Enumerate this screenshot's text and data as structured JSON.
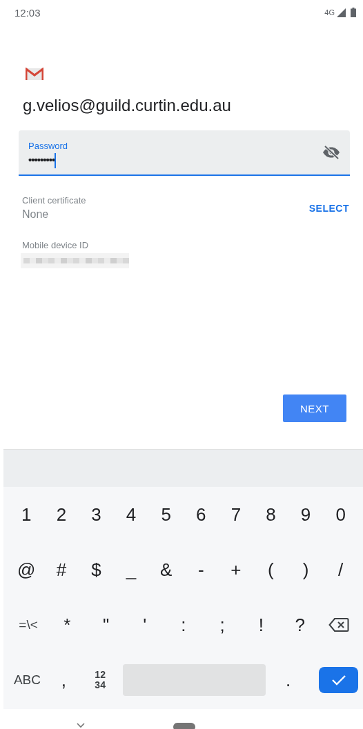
{
  "status_bar": {
    "time": "12:03",
    "network": "4G"
  },
  "account": {
    "email": "g.velios@guild.curtin.edu.au"
  },
  "password_field": {
    "label": "Password",
    "value": "•••••••••",
    "focused": true
  },
  "client_certificate": {
    "label": "Client certificate",
    "value": "None",
    "action": "SELECT"
  },
  "mobile_device_id": {
    "label": "Mobile device ID"
  },
  "next_button": {
    "label": "NEXT"
  },
  "keyboard": {
    "rows": [
      [
        {
          "kind": "char",
          "label": "1"
        },
        {
          "kind": "char",
          "label": "2"
        },
        {
          "kind": "char",
          "label": "3"
        },
        {
          "kind": "char",
          "label": "4"
        },
        {
          "kind": "char",
          "label": "5"
        },
        {
          "kind": "char",
          "label": "6"
        },
        {
          "kind": "char",
          "label": "7"
        },
        {
          "kind": "char",
          "label": "8"
        },
        {
          "kind": "char",
          "label": "9"
        },
        {
          "kind": "char",
          "label": "0"
        }
      ],
      [
        {
          "kind": "char",
          "label": "@"
        },
        {
          "kind": "char",
          "label": "#"
        },
        {
          "kind": "char",
          "label": "$"
        },
        {
          "kind": "char",
          "label": "_"
        },
        {
          "kind": "char",
          "label": "&"
        },
        {
          "kind": "char",
          "label": "-"
        },
        {
          "kind": "char",
          "label": "+"
        },
        {
          "kind": "char",
          "label": "("
        },
        {
          "kind": "char",
          "label": ")"
        },
        {
          "kind": "char",
          "label": "/"
        }
      ],
      [
        {
          "kind": "small",
          "label": "=\\<"
        },
        {
          "kind": "char",
          "label": "*"
        },
        {
          "kind": "char",
          "label": "\""
        },
        {
          "kind": "char",
          "label": "'"
        },
        {
          "kind": "char",
          "label": ":"
        },
        {
          "kind": "char",
          "label": ";"
        },
        {
          "kind": "char",
          "label": "!"
        },
        {
          "kind": "char",
          "label": "?"
        },
        {
          "kind": "backspace"
        }
      ],
      [
        {
          "kind": "small",
          "label": "ABC"
        },
        {
          "kind": "char",
          "label": ","
        },
        {
          "kind": "numpad",
          "lines": [
            "12",
            "34"
          ]
        },
        {
          "kind": "space"
        },
        {
          "kind": "char",
          "label": "."
        },
        {
          "kind": "enter"
        }
      ]
    ]
  }
}
